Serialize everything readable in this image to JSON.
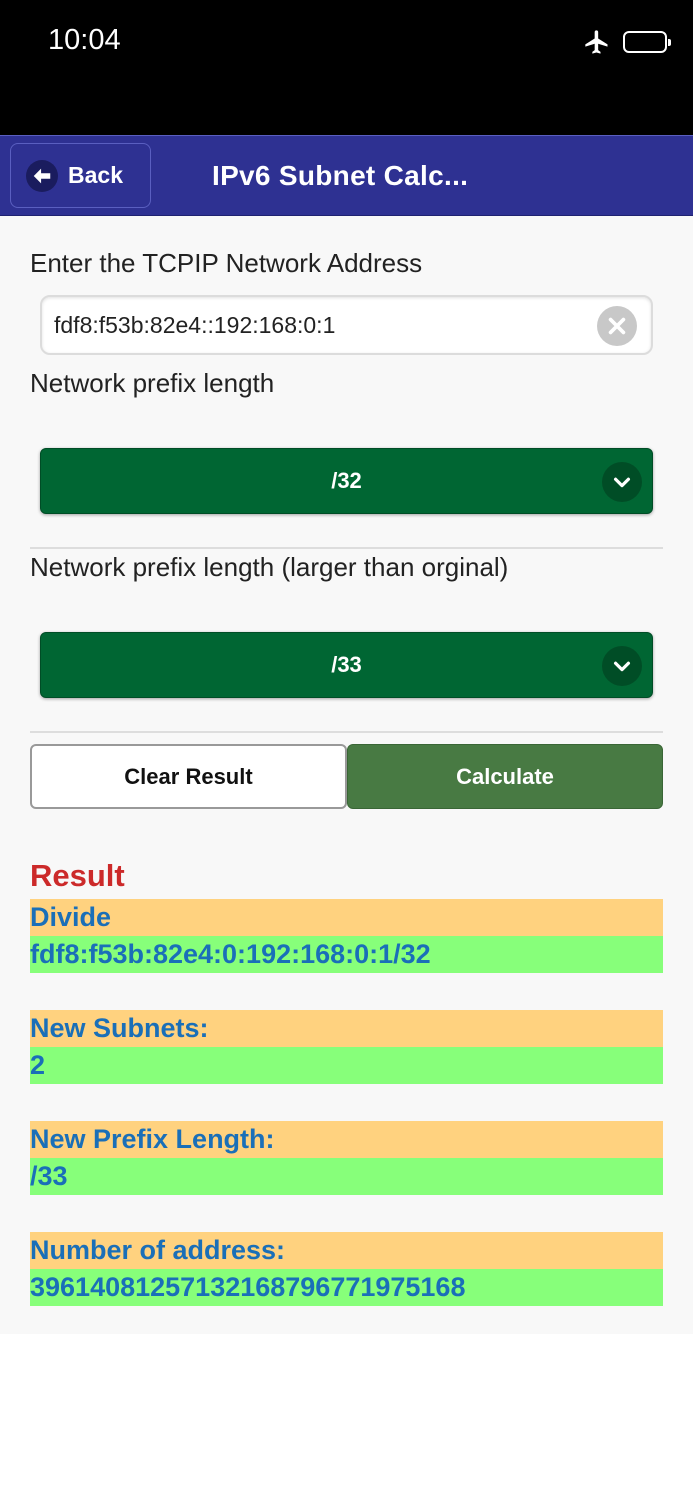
{
  "status_bar": {
    "time": "10:04"
  },
  "header": {
    "back_label": "Back",
    "title": "IPv6 Subnet Calc..."
  },
  "form": {
    "address_label": "Enter the TCPIP Network Address",
    "address_value": "fdf8:f53b:82e4::192:168:0:1",
    "prefix_label": "Network prefix length",
    "prefix_value": "/32",
    "new_prefix_label": "Network prefix length (larger than orginal)",
    "new_prefix_value": "/33"
  },
  "buttons": {
    "clear_label": "Clear Result",
    "calculate_label": "Calculate"
  },
  "result": {
    "title": "Result",
    "items": [
      {
        "label": "Divide",
        "value": "fdf8:f53b:82e4:0:192:168:0:1/32"
      },
      {
        "label": "New Subnets:",
        "value": "2"
      },
      {
        "label": "New Prefix Length:",
        "value": "/33"
      },
      {
        "label": "Number of address:",
        "value": "39614081257132168796771975168"
      }
    ]
  },
  "colors": {
    "header_bg": "#2e3192",
    "select_bg": "#006633",
    "calculate_bg": "#487a43",
    "result_title": "#cc2a2a",
    "result_label_bg": "#ffd27f",
    "result_value_bg": "#87ff7a",
    "result_text": "#1a6fb8"
  },
  "icons": {
    "back": "arrow-left-icon",
    "clear": "clear-x-icon",
    "chevron": "chevron-down-icon",
    "airplane": "airplane-icon",
    "battery": "battery-icon"
  }
}
